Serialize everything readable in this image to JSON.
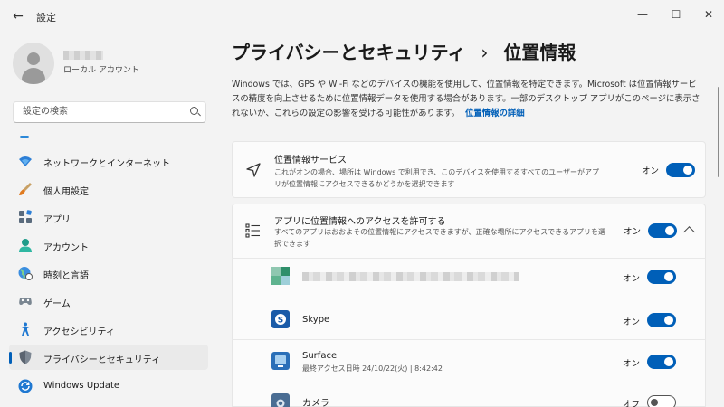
{
  "window": {
    "title": "設定",
    "back_glyph": "←",
    "minimize_glyph": "—",
    "maximize_glyph": "☐",
    "close_glyph": "✕"
  },
  "user": {
    "account_type": "ローカル アカウント"
  },
  "search": {
    "placeholder": "設定の検索"
  },
  "sidebar": {
    "items": [
      {
        "label": "ネットワークとインターネット",
        "icon": "wifi-icon"
      },
      {
        "label": "個人用設定",
        "icon": "brush-icon"
      },
      {
        "label": "アプリ",
        "icon": "apps-icon"
      },
      {
        "label": "アカウント",
        "icon": "account-icon"
      },
      {
        "label": "時刻と言語",
        "icon": "globe-clock-icon"
      },
      {
        "label": "ゲーム",
        "icon": "gamepad-icon"
      },
      {
        "label": "アクセシビリティ",
        "icon": "accessibility-icon"
      },
      {
        "label": "プライバシーとセキュリティ",
        "icon": "shield-icon",
        "selected": true
      },
      {
        "label": "Windows Update",
        "icon": "update-icon"
      }
    ]
  },
  "main": {
    "breadcrumb_parent": "プライバシーとセキュリティ",
    "breadcrumb_sep": "›",
    "breadcrumb_current": "位置情報",
    "description": "Windows では、GPS や Wi-Fi などのデバイスの機能を使用して、位置情報を特定できます。Microsoft は位置情報サービスの精度を向上させるために位置情報データを使用する場合があります。一部のデスクトップ アプリがこのページに表示されないか、これらの設定の影響を受ける可能性があります。",
    "description_link": "位置情報の詳細",
    "location_service": {
      "title": "位置情報サービス",
      "subtitle": "これがオンの場合、場所は Windows で利用でき、このデバイスを使用するすべてのユーザーがアプリが位置情報にアクセスできるかどうかを選択できます",
      "toggle_label": "オン",
      "on": true
    },
    "app_access": {
      "title": "アプリに位置情報へのアクセスを許可する",
      "subtitle": "すべてのアプリはおおよその位置情報にアクセスできますが、正確な場所にアクセスできるアプリを選択できます",
      "toggle_label": "オン",
      "on": true
    },
    "apps": [
      {
        "name": "",
        "detail": "",
        "toggle_label": "オン",
        "on": true
      },
      {
        "name": "Skype",
        "detail": "",
        "toggle_label": "オン",
        "on": true
      },
      {
        "name": "Surface",
        "detail": "最終アクセス日時 24/10/22(火) | 8:42:42",
        "toggle_label": "オン",
        "on": true
      },
      {
        "name": "カメラ",
        "detail": "",
        "toggle_label": "オフ",
        "on": false
      }
    ]
  },
  "colors": {
    "accent": "#005fb8",
    "background": "#f3f3f3",
    "card": "#fbfbfb"
  }
}
